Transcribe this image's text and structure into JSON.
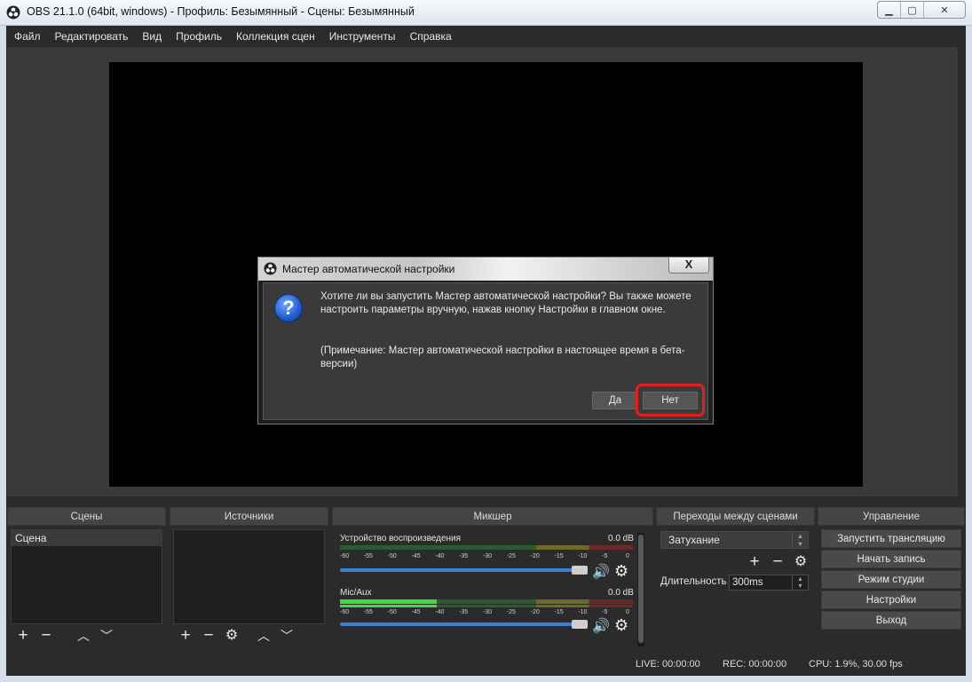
{
  "window": {
    "title": "OBS 21.1.0 (64bit, windows) - Профиль: Безымянный - Сцены: Безымянный",
    "min": "▁",
    "max": "▢",
    "close": "✕"
  },
  "menu": [
    "Файл",
    "Редактировать",
    "Вид",
    "Профиль",
    "Коллекция сцен",
    "Инструменты",
    "Справка"
  ],
  "docks": {
    "scenes": "Сцены",
    "sources": "Источники",
    "mixer": "Микшер",
    "transitions": "Переходы между сценами",
    "controls": "Управление"
  },
  "scenes": {
    "items": [
      "Сцена"
    ]
  },
  "mixer": {
    "tracks": [
      {
        "name": "Устройство воспроизведения",
        "db": "0.0 dB"
      },
      {
        "name": "Mic/Aux",
        "db": "0.0 dB"
      }
    ],
    "ticks": [
      "-60",
      "-55",
      "-50",
      "-45",
      "-40",
      "-35",
      "-30",
      "-25",
      "-20",
      "-15",
      "-10",
      "-5",
      "0"
    ]
  },
  "transitions": {
    "selected": "Затухание",
    "duration_label": "Длительность",
    "duration_value": "300ms"
  },
  "controls": [
    "Запустить трансляцию",
    "Начать запись",
    "Режим студии",
    "Настройки",
    "Выход"
  ],
  "status": {
    "live": "LIVE: 00:00:00",
    "rec": "REC: 00:00:00",
    "cpu": "CPU: 1.9%, 30.00 fps"
  },
  "dialog": {
    "title": "Мастер автоматической настройки",
    "close": "X",
    "message": "Хотите ли вы запустить Мастер автоматической настройки? Вы также можете настроить параметры вручную, нажав кнопку Настройки в главном окне.",
    "note": "(Примечание: Мастер автоматической настройки в настоящее время в бета-версии)",
    "yes": "Да",
    "no": "Нет",
    "highlight_color": "#e02020"
  },
  "icons": {
    "add": "+",
    "remove": "−",
    "up": "︿",
    "down": "﹀",
    "speaker": "🔊",
    "gear": "⚙"
  }
}
